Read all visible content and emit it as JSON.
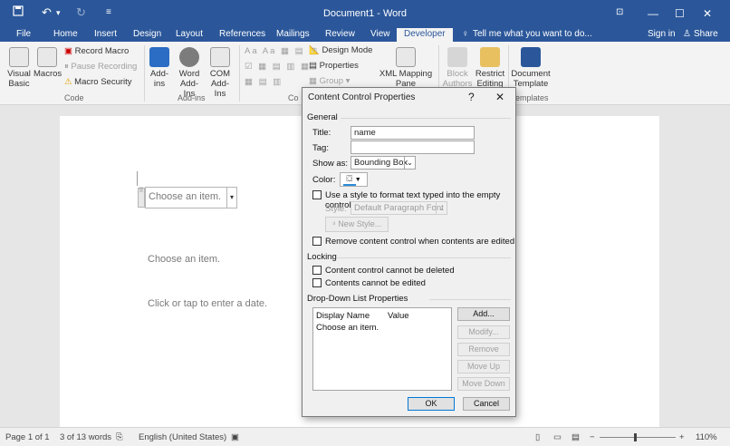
{
  "titlebar": {
    "title": "Document1 - Word",
    "save_icon": "save-icon",
    "undo_icon": "undo-icon",
    "redo_icon": "redo-icon",
    "customize_icon": "customize-qat-icon",
    "minimize": "—",
    "maximize": "☐",
    "close": "✕",
    "ribbon_display": "⊡"
  },
  "tabs": {
    "file": "File",
    "home": "Home",
    "insert": "Insert",
    "design": "Design",
    "layout": "Layout",
    "references": "References",
    "mailings": "Mailings",
    "review": "Review",
    "view": "View",
    "developer": "Developer",
    "tell_me": "Tell me what you want to do...",
    "sign_in": "Sign in",
    "share": "Share"
  },
  "ribbon": {
    "visual_basic": "Visual Basic",
    "macros": "Macros",
    "record_macro": "Record Macro",
    "pause_recording": "Pause Recording",
    "macro_security": "Macro Security",
    "group_code": "Code",
    "add_ins": "Add-ins",
    "word_add_ins": "Word Add-Ins",
    "com_add_ins": "COM Add-Ins",
    "group_add_ins": "Add-ins",
    "design_mode": "Design Mode",
    "properties": "Properties",
    "group_menu": "Group",
    "group_controls_partial": "Co",
    "xml_mapping": "XML Mapping Pane",
    "block_authors": "Block Authors",
    "restrict_editing": "Restrict Editing",
    "document_template": "Document Template",
    "group_templates_partial": "emplates"
  },
  "document": {
    "cc_placeholder": "Choose an item.",
    "line2": "Choose an item.",
    "line3": "Click or tap to enter a date."
  },
  "dialog": {
    "title": "Content Control Properties",
    "help": "?",
    "close": "✕",
    "general": "General",
    "title_label": "Title:",
    "title_value": "name",
    "tag_label": "Tag:",
    "tag_value": "",
    "show_as_label": "Show as:",
    "show_as_value": "Bounding Box",
    "color_label": "Color:",
    "use_style": "Use a style to format text typed into the empty control",
    "style_label": "Style:",
    "style_value": "Default Paragraph Font",
    "new_style": "New Style...",
    "remove_when_edited": "Remove content control when contents are edited",
    "locking": "Locking",
    "cannot_delete": "Content control cannot be deleted",
    "cannot_edit": "Contents cannot be edited",
    "dropdown_props": "Drop-Down List Properties",
    "col_display": "Display Name",
    "col_value": "Value",
    "items": [
      {
        "display": "Choose an item.",
        "value": ""
      }
    ],
    "add": "Add...",
    "modify": "Modify...",
    "remove": "Remove",
    "move_up": "Move Up",
    "move_down": "Move Down",
    "ok": "OK",
    "cancel": "Cancel"
  },
  "status": {
    "page": "Page 1 of 1",
    "words": "3 of 13 words",
    "language": "English (United States)",
    "zoom": "110%",
    "zoom_minus": "−",
    "zoom_plus": "+"
  },
  "colors": {
    "accent": "#2b579a",
    "highlight": "#c42b1c"
  }
}
